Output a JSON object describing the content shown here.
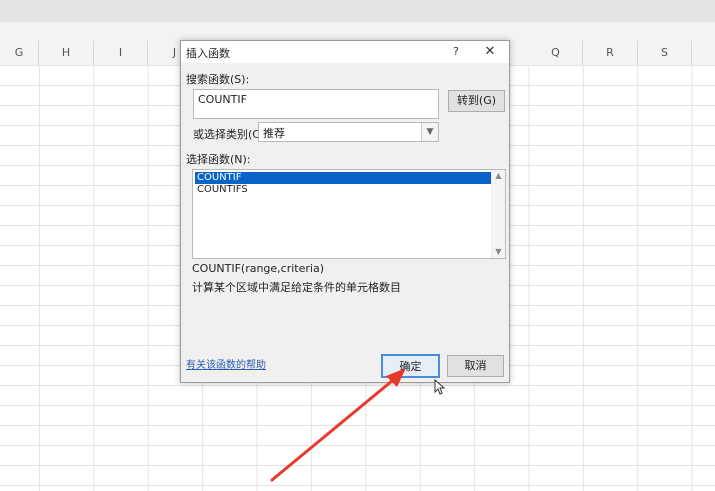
{
  "spreadsheet": {
    "columns": [
      "G",
      "H",
      "I",
      "J",
      "",
      "",
      "",
      "",
      "",
      "",
      "Q",
      "R",
      "S"
    ]
  },
  "dialog": {
    "title": "插入函数",
    "help_label": "?",
    "close_label": "✕",
    "search_label": "搜索函数(S):",
    "search_value": "COUNTIF",
    "goto_button": "转到(G)",
    "category_label": "或选择类别(C):",
    "category_value": "推荐",
    "select_label": "选择函数(N):",
    "functions": [
      "COUNTIF",
      "COUNTIFS"
    ],
    "selected_function": "COUNTIF",
    "syntax": "COUNTIF(range,criteria)",
    "description": "计算某个区域中满足给定条件的单元格数目",
    "help_link": "有关该函数的帮助",
    "ok_button": "确定",
    "cancel_button": "取消"
  },
  "annotation": {
    "arrow_color": "#e8392c"
  }
}
